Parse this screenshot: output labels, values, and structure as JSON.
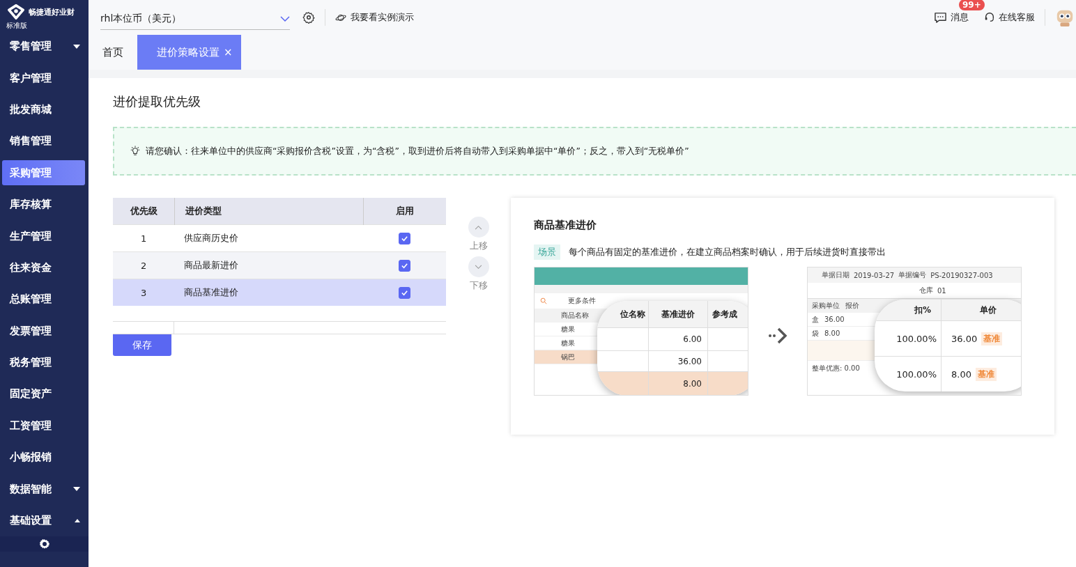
{
  "brand": {
    "name": "畅捷通好业财",
    "edition": "标准版"
  },
  "sidebar": {
    "items": [
      {
        "label": "零售管理",
        "kind": "group",
        "expanded": false,
        "selected": false
      },
      {
        "label": "客户管理",
        "kind": "link",
        "selected": false
      },
      {
        "label": "批发商城",
        "kind": "link",
        "selected": false
      },
      {
        "label": "销售管理",
        "kind": "link",
        "selected": false
      },
      {
        "label": "采购管理",
        "kind": "link",
        "selected": true
      },
      {
        "label": "库存核算",
        "kind": "link",
        "selected": false
      },
      {
        "label": "生产管理",
        "kind": "link",
        "selected": false
      },
      {
        "label": "往来资金",
        "kind": "link",
        "selected": false
      },
      {
        "label": "总账管理",
        "kind": "link",
        "selected": false
      },
      {
        "label": "发票管理",
        "kind": "link",
        "selected": false
      },
      {
        "label": "税务管理",
        "kind": "link",
        "selected": false
      },
      {
        "label": "固定资产",
        "kind": "link",
        "selected": false
      },
      {
        "label": "工资管理",
        "kind": "link",
        "selected": false
      },
      {
        "label": "小畅报销",
        "kind": "link",
        "selected": false
      },
      {
        "label": "数据智能",
        "kind": "group",
        "expanded": false,
        "selected": false
      },
      {
        "label": "基础设置",
        "kind": "group",
        "expanded": true,
        "selected": false
      }
    ]
  },
  "topbar": {
    "currency": "rhl本位币（美元）",
    "demo_link": "我要看实例演示",
    "messages": {
      "label": "消息",
      "badge": "99+"
    },
    "support": "在线客服"
  },
  "tabs": [
    {
      "label": "首页",
      "selected": false
    },
    {
      "label": "进价策略设置",
      "selected": true,
      "close": "×"
    }
  ],
  "page": {
    "title": "进价提取优先级",
    "notice": "请您确认：往来单位中的供应商“采购报价含税”设置，为“含税”，取到进价后将自动带入到采购单据中“单价”；反之，带入到“无税单价”",
    "table": {
      "columns": [
        "优先级",
        "进价类型",
        "启用"
      ],
      "rows": [
        {
          "priority": "1",
          "type": "供应商历史价",
          "enabled": true,
          "selected": false
        },
        {
          "priority": "2",
          "type": "商品最新进价",
          "enabled": true,
          "selected": false
        },
        {
          "priority": "3",
          "type": "商品基准进价",
          "enabled": true,
          "selected": true
        }
      ]
    },
    "move_up": "上移",
    "move_down": "下移",
    "save": "保存"
  },
  "detail": {
    "title": "商品基准进价",
    "tag": "场景",
    "description": "每个商品有固定的基准进价，在建立商品档案时确认，用于后续进货时直接带出",
    "before": {
      "filter": "更多条件",
      "column": "商品名称",
      "rows": [
        "糖果",
        "糖果",
        "锅巴"
      ],
      "zoom": {
        "columns": [
          "位名称",
          "基准进价",
          "参考成"
        ],
        "values": [
          "6.00",
          "36.00",
          "8.00"
        ]
      }
    },
    "after": {
      "date_label": "单据日期",
      "date": "2019-03-27",
      "number_label": "单据编号",
      "number": "PS-20190327-003",
      "warehouse_label": "仓库",
      "warehouse": "01",
      "columns": [
        "采购单位",
        "报价"
      ],
      "rows": [
        {
          "unit": "盒",
          "price": "36.00"
        },
        {
          "unit": "袋",
          "price": "8.00"
        }
      ],
      "discount": "整单优惠: 0.00",
      "zoom": {
        "columns": [
          "扣%",
          "单价"
        ],
        "rows": [
          {
            "discount": "100.00%",
            "price": "36.00",
            "tag": "基准"
          },
          {
            "discount": "100.00%",
            "price": "8.00",
            "tag": "基准"
          }
        ]
      }
    }
  }
}
